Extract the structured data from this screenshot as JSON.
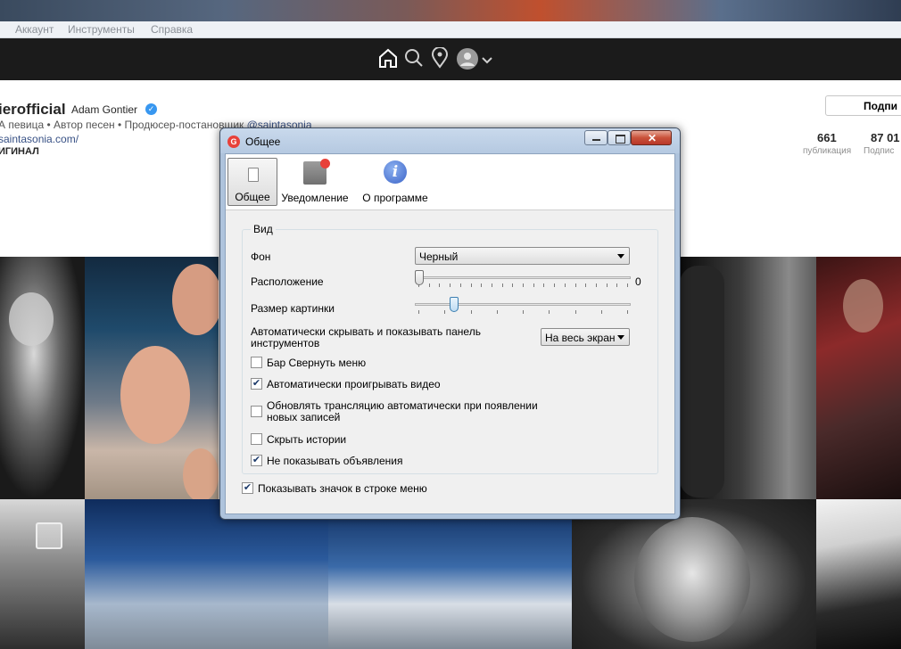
{
  "menu": {
    "items": [
      "Аккаунт",
      "Инструменты",
      "Справка"
    ]
  },
  "nav": {
    "icons": [
      "home-icon",
      "search-icon",
      "location-pin-icon",
      "avatar-icon",
      "chevron-down-icon"
    ]
  },
  "profile": {
    "username": "ierofficial",
    "full_name": "Adam Gontier",
    "bio_text": "А певица • Автор песен • Продюсер-постановщик ",
    "bio_mention": "@saintasonia",
    "website": "saintasonia.com/",
    "original_label": "ИГИНАЛ",
    "follow_label": "Подпи",
    "posts_count": "661",
    "posts_label": "публикация",
    "followers_count": "87 01",
    "followers_label": "Подпис"
  },
  "dialog": {
    "title": "Общее",
    "toolbar": {
      "general": "Общее",
      "notifications": "Уведомление",
      "about": "О программе"
    },
    "group_title": "Вид",
    "background_label": "Фон",
    "background_value": "Черный",
    "position_label": "Расположение",
    "position_value": "0",
    "position_level": 0,
    "image_size_label": "Размер картинки",
    "image_size_level": 0.17,
    "autohide_label_line1": "Автоматически скрывать и показывать панель",
    "autohide_label_line2": "инструментов",
    "autohide_value": "На весь экран",
    "checkboxes": [
      {
        "label": "Бар Свернуть меню",
        "checked": false
      },
      {
        "label": "Автоматически проигрывать видео",
        "checked": true
      },
      {
        "label": "Обновлять трансляцию автоматически при появлении",
        "label2": "новых записей",
        "checked": false
      },
      {
        "label": "Скрыть истории",
        "checked": false
      },
      {
        "label": "Не показывать объявления",
        "checked": true
      }
    ],
    "menu_icon_label": "Показывать значок в строке меню",
    "menu_icon_checked": true
  },
  "colors": {
    "accent": "#3897f0",
    "close_button": "#c9523a",
    "notification_badge": "#e8413a",
    "info_icon": "#4a78d6"
  }
}
